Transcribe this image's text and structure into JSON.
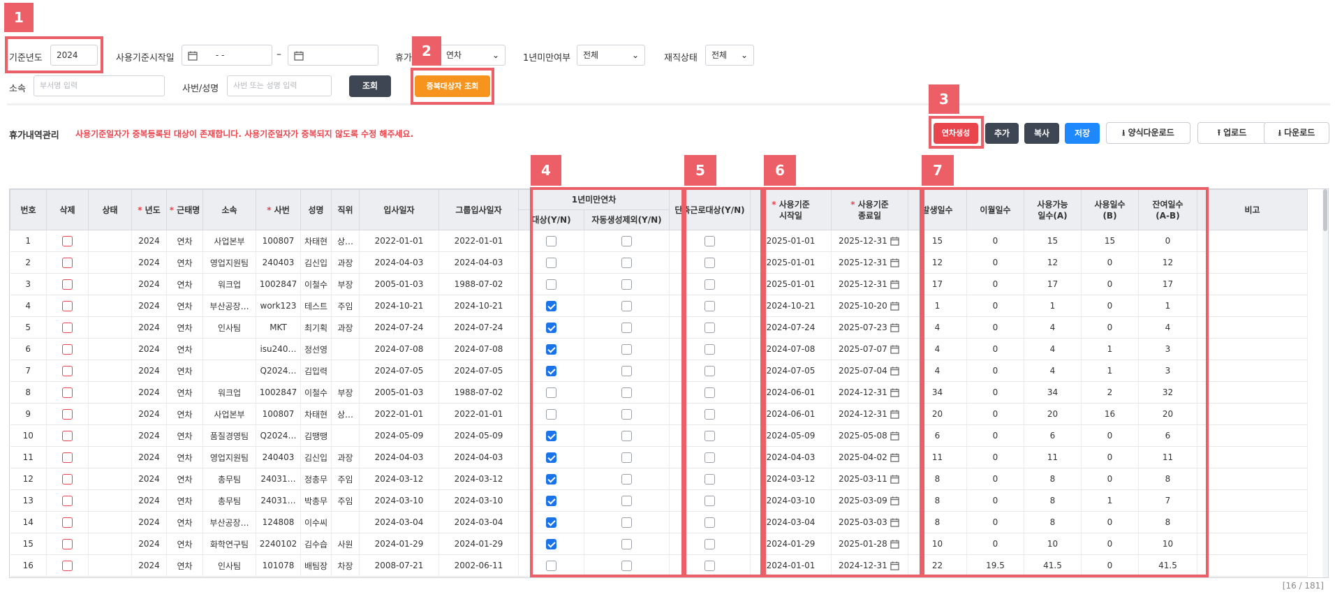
{
  "filters": {
    "year_label": "기준년도",
    "year_value": "2024",
    "use_start_label": "사용기준시작일",
    "date_from_value": "- -",
    "date_sep": "–",
    "leave_type_label": "휴가",
    "leave_type_value": "연차",
    "under_one_year_label": "1년미만여부",
    "under_one_year_value": "전체",
    "employment_label": "재직상태",
    "employment_value": "전체",
    "dept_label": "소속",
    "dept_placeholder": "부서명 입력",
    "emp_label": "사번/성명",
    "emp_placeholder": "사번 또는 성명 입력",
    "search_button": "조회",
    "dup_button": "중복대상자 조회"
  },
  "section": {
    "title": "휴가내역관리",
    "warning": "사용기준일자가 중복등록된 대상이 존재합니다. 사용기준일자가 중복되지 않도록 수정 해주세요."
  },
  "toolbar": {
    "generate": "연차생성",
    "add": "추가",
    "copy": "복사",
    "save": "저장",
    "template_download": "양식다운로드",
    "upload": "업로드",
    "download": "다운로드"
  },
  "annotations": [
    "1",
    "2",
    "3",
    "4",
    "5",
    "6",
    "7"
  ],
  "grid": {
    "headers": {
      "no": "번호",
      "del": "삭제",
      "status": "상태",
      "year": "년도",
      "leave": "근태명",
      "dept": "소속",
      "empno": "사번",
      "name": "성명",
      "position": "직위",
      "hire": "입사일자",
      "group_hire": "그룹입사일자",
      "under1": "1년미만연차",
      "target": "대상(Y/N)",
      "auto_ex": "자동생성제외(Y/N)",
      "short": "단축근로대상(Y/N)",
      "start_a": "사용기준",
      "start_b": "시작일",
      "end_a": "사용기준",
      "end_b": "종료일",
      "occur": "발생일수",
      "carry": "이월일수",
      "avail_a": "사용가능",
      "avail_b": "일수(A)",
      "used_a": "사용일수",
      "used_b": "(B)",
      "remain_a": "잔여일수",
      "remain_b": "(A-B)",
      "note": "비고"
    },
    "rows": [
      {
        "no": "1",
        "year": "2024",
        "leave": "연차",
        "dept": "사업본부",
        "empno": "100807",
        "name": "차태현",
        "pos": "상…",
        "hire": "2022-01-01",
        "ghire": "2022-01-01",
        "target": false,
        "start": "2025-01-01",
        "end": "2025-12-31",
        "occur": "15",
        "carry": "0",
        "avail": "15",
        "used": "15",
        "remain": "0"
      },
      {
        "no": "2",
        "year": "2024",
        "leave": "연차",
        "dept": "영업지원팀",
        "empno": "240403",
        "name": "김신입",
        "pos": "과장",
        "hire": "2024-04-03",
        "ghire": "2024-04-03",
        "target": false,
        "start": "2025-01-01",
        "end": "2025-12-31",
        "occur": "12",
        "carry": "0",
        "avail": "12",
        "used": "0",
        "remain": "12"
      },
      {
        "no": "3",
        "year": "2024",
        "leave": "연차",
        "dept": "워크업",
        "empno": "1002847",
        "name": "이철수",
        "pos": "부장",
        "hire": "2005-01-03",
        "ghire": "1988-07-02",
        "target": false,
        "start": "2025-01-01",
        "end": "2025-12-31",
        "occur": "17",
        "carry": "0",
        "avail": "17",
        "used": "0",
        "remain": "17"
      },
      {
        "no": "4",
        "year": "2024",
        "leave": "연차",
        "dept": "부산공장…",
        "empno": "work123",
        "name": "테스트",
        "pos": "주임",
        "hire": "2024-10-21",
        "ghire": "2024-10-21",
        "target": true,
        "start": "2024-10-21",
        "end": "2025-10-20",
        "occur": "1",
        "carry": "0",
        "avail": "1",
        "used": "0",
        "remain": "1"
      },
      {
        "no": "5",
        "year": "2024",
        "leave": "연차",
        "dept": "인사팀",
        "empno": "MKT",
        "name": "최기획",
        "pos": "과장",
        "hire": "2024-07-24",
        "ghire": "2024-07-24",
        "target": true,
        "start": "2024-07-24",
        "end": "2025-07-23",
        "occur": "4",
        "carry": "0",
        "avail": "4",
        "used": "0",
        "remain": "4"
      },
      {
        "no": "6",
        "year": "2024",
        "leave": "연차",
        "dept": "",
        "empno": "isu240…",
        "name": "정선영",
        "pos": "",
        "hire": "2024-07-08",
        "ghire": "2024-07-08",
        "target": true,
        "start": "2024-07-08",
        "end": "2025-07-07",
        "occur": "4",
        "carry": "0",
        "avail": "4",
        "used": "1",
        "remain": "3"
      },
      {
        "no": "7",
        "year": "2024",
        "leave": "연차",
        "dept": "",
        "empno": "Q2024…",
        "name": "김입력",
        "pos": "",
        "hire": "2024-07-05",
        "ghire": "2024-07-05",
        "target": true,
        "start": "2024-07-05",
        "end": "2025-07-04",
        "occur": "4",
        "carry": "0",
        "avail": "4",
        "used": "1",
        "remain": "3"
      },
      {
        "no": "8",
        "year": "2024",
        "leave": "연차",
        "dept": "워크업",
        "empno": "1002847",
        "name": "이철수",
        "pos": "부장",
        "hire": "2005-01-03",
        "ghire": "1988-07-02",
        "target": false,
        "start": "2024-06-01",
        "end": "2024-12-31",
        "occur": "34",
        "carry": "0",
        "avail": "34",
        "used": "2",
        "remain": "32"
      },
      {
        "no": "9",
        "year": "2024",
        "leave": "연차",
        "dept": "사업본부",
        "empno": "100807",
        "name": "차태현",
        "pos": "상…",
        "hire": "2022-01-01",
        "ghire": "2022-01-01",
        "target": false,
        "start": "2024-06-01",
        "end": "2024-12-31",
        "occur": "20",
        "carry": "0",
        "avail": "20",
        "used": "16",
        "remain": "20"
      },
      {
        "no": "10",
        "year": "2024",
        "leave": "연차",
        "dept": "품질경영팀",
        "empno": "Q2024…",
        "name": "김땡땡",
        "pos": "",
        "hire": "2024-05-09",
        "ghire": "2024-05-09",
        "target": true,
        "start": "2024-05-09",
        "end": "2025-05-08",
        "occur": "6",
        "carry": "0",
        "avail": "6",
        "used": "0",
        "remain": "6"
      },
      {
        "no": "11",
        "year": "2024",
        "leave": "연차",
        "dept": "영업지원팀",
        "empno": "240403",
        "name": "김신입",
        "pos": "과장",
        "hire": "2024-04-03",
        "ghire": "2024-04-03",
        "target": true,
        "start": "2024-04-03",
        "end": "2025-04-02",
        "occur": "11",
        "carry": "0",
        "avail": "11",
        "used": "0",
        "remain": "11"
      },
      {
        "no": "12",
        "year": "2024",
        "leave": "연차",
        "dept": "총무팀",
        "empno": "24031…",
        "name": "정총무",
        "pos": "주임",
        "hire": "2024-03-12",
        "ghire": "2024-03-12",
        "target": true,
        "start": "2024-03-12",
        "end": "2025-03-11",
        "occur": "8",
        "carry": "0",
        "avail": "8",
        "used": "0",
        "remain": "8"
      },
      {
        "no": "13",
        "year": "2024",
        "leave": "연차",
        "dept": "총무팀",
        "empno": "24031…",
        "name": "박총무",
        "pos": "주임",
        "hire": "2024-03-10",
        "ghire": "2024-03-10",
        "target": true,
        "start": "2024-03-10",
        "end": "2025-03-09",
        "occur": "8",
        "carry": "0",
        "avail": "8",
        "used": "1",
        "remain": "7"
      },
      {
        "no": "14",
        "year": "2024",
        "leave": "연차",
        "dept": "부산공장…",
        "empno": "124808",
        "name": "이수씨",
        "pos": "",
        "hire": "2024-03-04",
        "ghire": "2024-03-04",
        "target": true,
        "start": "2024-03-04",
        "end": "2025-03-03",
        "occur": "8",
        "carry": "0",
        "avail": "8",
        "used": "0",
        "remain": "8"
      },
      {
        "no": "15",
        "year": "2024",
        "leave": "연차",
        "dept": "화학연구팀",
        "empno": "2240102",
        "name": "김수습",
        "pos": "사원",
        "hire": "2024-01-29",
        "ghire": "2024-01-29",
        "target": true,
        "start": "2024-01-29",
        "end": "2025-01-28",
        "occur": "10",
        "carry": "0",
        "avail": "10",
        "used": "0",
        "remain": "10"
      },
      {
        "no": "16",
        "year": "2024",
        "leave": "연차",
        "dept": "인사팀",
        "empno": "101078",
        "name": "배팀장",
        "pos": "차장",
        "hire": "2008-07-21",
        "ghire": "2002-06-11",
        "target": false,
        "start": "2024-01-01",
        "end": "2024-12-31",
        "occur": "22",
        "carry": "19.5",
        "avail": "41.5",
        "used": "0",
        "remain": "41.5"
      }
    ]
  },
  "footer": {
    "count": "[16 / 181]"
  },
  "colors": {
    "annotation": "#ec5f66",
    "warning": "#e8454d",
    "accent_blue": "#1e88ff",
    "orange": "#f7941d",
    "dark_button": "#3e4654"
  }
}
